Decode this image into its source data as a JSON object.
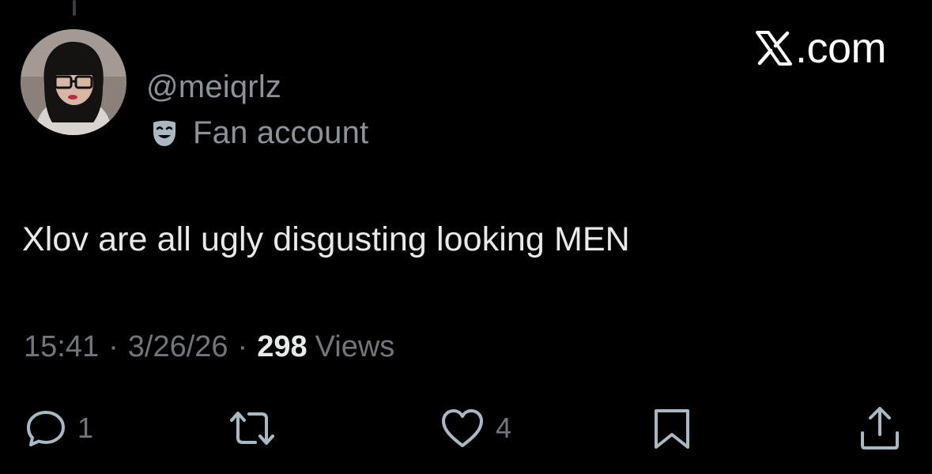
{
  "watermark": {
    "text": ".com",
    "icon": "x-logo-icon"
  },
  "author": {
    "handle": "@meiqrlz",
    "badge_label": "Fan account",
    "badge_icon": "theater-mask-icon",
    "avatar": "avatar"
  },
  "tweet": {
    "text": "Xlov are all ugly disgusting looking MEN"
  },
  "meta": {
    "time": "15:41",
    "separator": "·",
    "date": "3/26/26",
    "views_count": "298",
    "views_label": "Views"
  },
  "actions": {
    "reply": {
      "icon": "reply-icon",
      "count": "1"
    },
    "retweet": {
      "icon": "retweet-icon",
      "count": ""
    },
    "like": {
      "icon": "heart-icon",
      "count": "4"
    },
    "bookmark": {
      "icon": "bookmark-icon",
      "count": ""
    },
    "share": {
      "icon": "share-icon",
      "count": ""
    }
  },
  "colors": {
    "background": "#000000",
    "primary_text": "#e7e9ea",
    "secondary_text": "#71767b",
    "handle_text": "#8b9299",
    "badge_icon": "#aab8c2"
  }
}
